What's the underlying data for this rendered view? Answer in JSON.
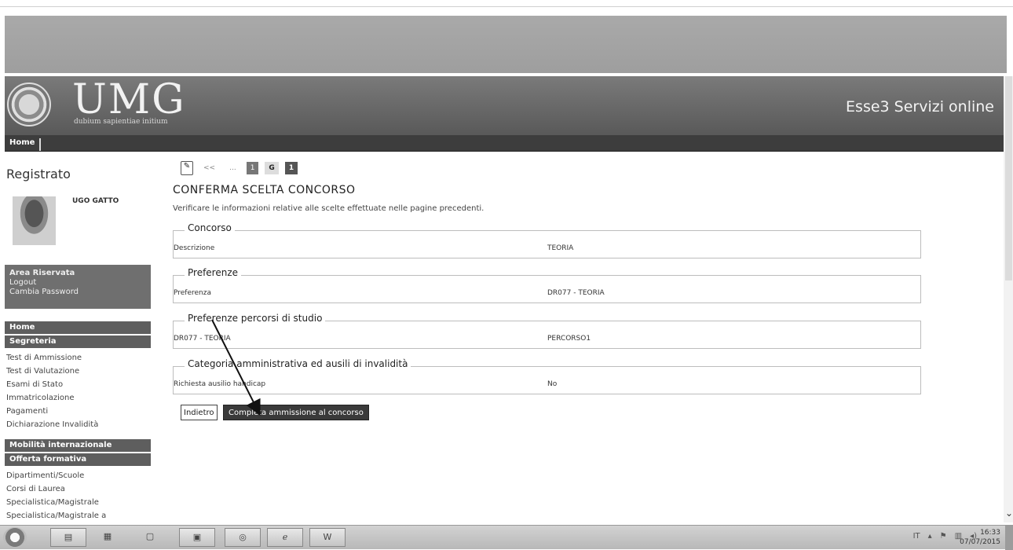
{
  "header": {
    "logo_text": "UMG",
    "motto": "dubium sapientiae initium",
    "site_title": "Esse3 Servizi online"
  },
  "nav": {
    "home": "Home"
  },
  "sidebar": {
    "title": "Registrato",
    "user_name": "UGO GATTO",
    "area": {
      "title": "Area Riservata",
      "logout": "Logout",
      "change_password": "Cambia Password"
    },
    "sections": [
      {
        "label": "Home"
      },
      {
        "label": "Segreteria"
      }
    ],
    "segreteria_links": [
      "Test di Ammissione",
      "Test di Valutazione",
      "Esami di Stato",
      "Immatricolazione",
      "Pagamenti",
      "Dichiarazione Invalidità"
    ],
    "mobility": "Mobilità internazionale",
    "offerta": "Offerta formativa",
    "offerta_links": [
      "Dipartimenti/Scuole",
      "Corsi di Laurea",
      "Specialistica/Magistrale",
      "Specialistica/Magistrale a"
    ]
  },
  "breadcrumbs": [
    "<<",
    "...",
    "1",
    "G",
    "1"
  ],
  "main": {
    "title": "CONFERMA SCELTA CONCORSO",
    "intro": "Verificare le informazioni relative alle scelte effettuate nelle pagine precedenti.",
    "sections": [
      {
        "legend": "Concorso",
        "label": "Descrizione",
        "value": "TEORIA"
      },
      {
        "legend": "Preferenze",
        "label": "Preferenza",
        "value": "DR077 - TEORIA"
      },
      {
        "legend": "Preferenze percorsi di studio",
        "label": "DR077 - TEORIA",
        "value": "PERCORSO1"
      },
      {
        "legend": "Categoria amministrativa ed ausili di invalidità",
        "label": "Richiesta ausilio handicap",
        "value": "No"
      }
    ],
    "back_button": "Indietro",
    "complete_button": "Completa ammissione al concorso"
  },
  "taskbar": {
    "time": "16:33",
    "date": "07/07/2015"
  }
}
